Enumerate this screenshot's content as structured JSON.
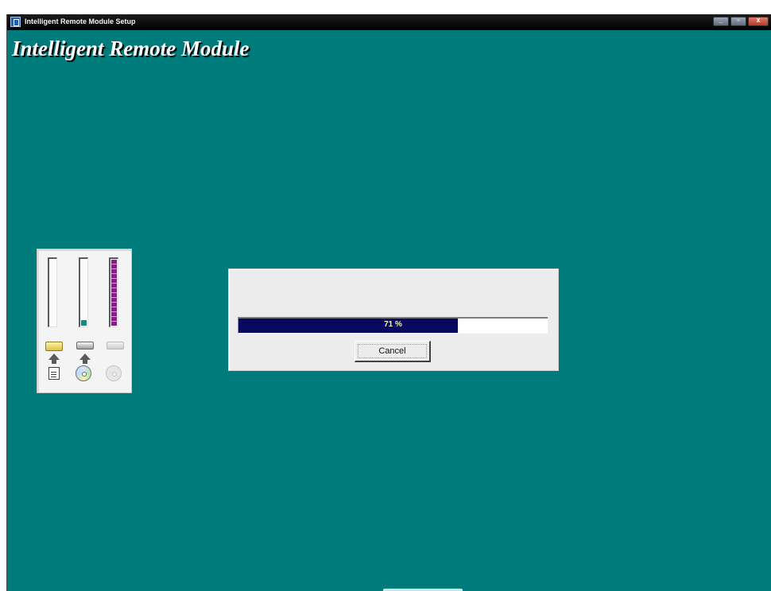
{
  "window": {
    "title": "Intelligent Remote Module Setup",
    "app_icon": "setup-icon",
    "controls": {
      "minimize_icon": "minimize-icon",
      "maximize_icon": "maximize-icon",
      "close_icon": "close-icon"
    }
  },
  "app_title": "Intelligent Remote Module",
  "disk_panel": {
    "gauges": [
      {
        "name": "source",
        "fill_fraction": 0.0,
        "color": "#ffffff",
        "icon": "folder-icon"
      },
      {
        "name": "destination",
        "fill_fraction": 0.08,
        "color": "#0f8a8a",
        "icon": "cd-drive-icon"
      },
      {
        "name": "third",
        "fill_fraction": 0.98,
        "color": "#8a1b8a",
        "icon": "drive-icon"
      }
    ]
  },
  "progress_dialog": {
    "percent_text": "71 %",
    "progress_fraction": 0.71,
    "bar_color": "#07085e",
    "cancel_label": "Cancel"
  },
  "colors": {
    "background": "#007b7b",
    "titlebar": "#000000"
  }
}
